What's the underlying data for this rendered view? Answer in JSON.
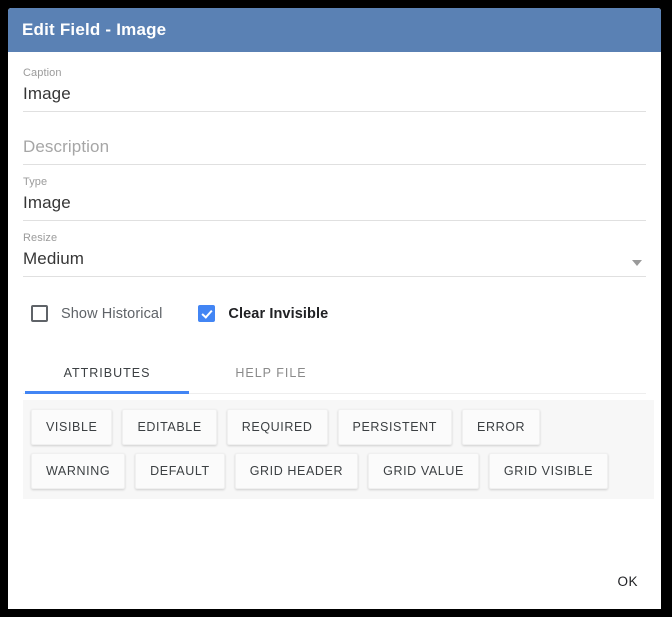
{
  "dialog": {
    "title": "Edit Field - Image",
    "header_color": "#5a81b4",
    "accent_color": "#4285f4"
  },
  "form": {
    "caption": {
      "label": "Caption",
      "value": "Image"
    },
    "description": {
      "placeholder": "Description",
      "value": ""
    },
    "type": {
      "label": "Type",
      "value": "Image"
    },
    "resize": {
      "label": "Resize",
      "value": "Medium"
    }
  },
  "checkboxes": [
    {
      "label": "Show Historical",
      "checked": false
    },
    {
      "label": "Clear Invisible",
      "checked": true
    }
  ],
  "tabs": [
    {
      "label": "ATTRIBUTES",
      "active": true
    },
    {
      "label": "HELP FILE",
      "active": false
    }
  ],
  "attributes": {
    "row1": [
      "VISIBLE",
      "EDITABLE",
      "REQUIRED",
      "PERSISTENT",
      "ERROR"
    ],
    "row2": [
      "WARNING",
      "DEFAULT",
      "GRID HEADER",
      "GRID VALUE",
      "GRID VISIBLE"
    ]
  },
  "footer": {
    "ok_label": "OK"
  }
}
